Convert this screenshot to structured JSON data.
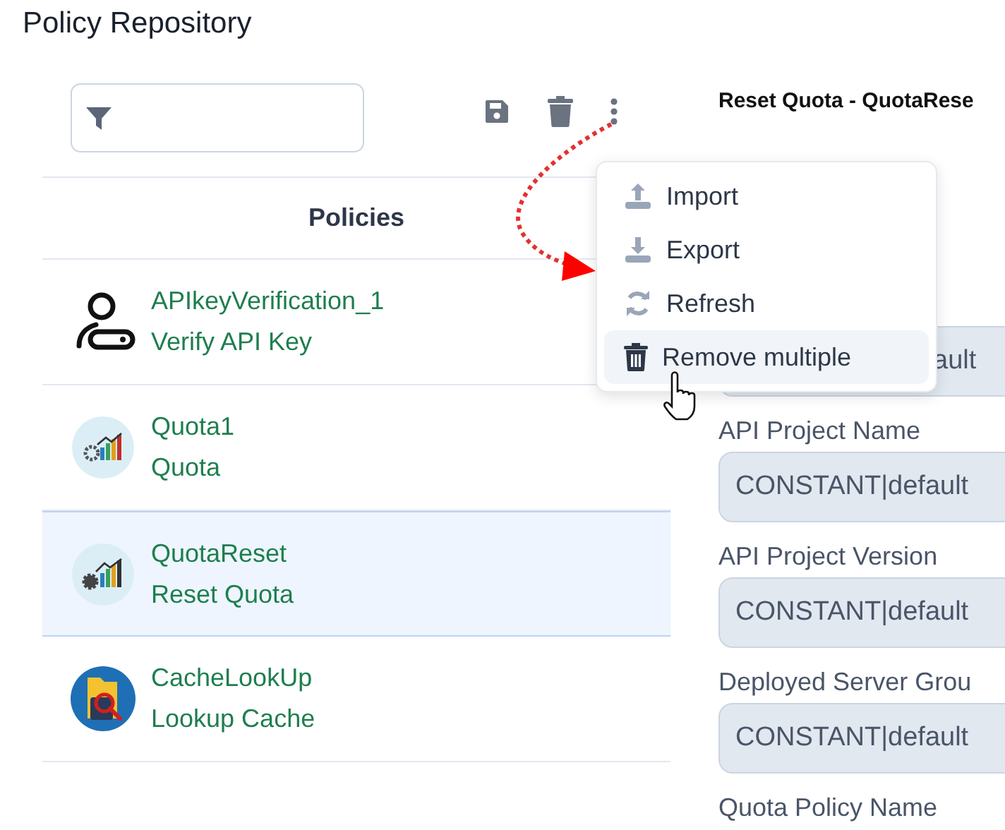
{
  "title": "Policy Repository",
  "toolbar": [
    {
      "kind": "save"
    },
    {
      "kind": "trash"
    },
    {
      "kind": "more"
    }
  ],
  "policies_header": "Policies",
  "policies": [
    {
      "name": "APIkeyVerification_1",
      "type": "Verify API Key",
      "kind": "key-user",
      "selected": false
    },
    {
      "name": "Quota1",
      "type": "Quota",
      "kind": "quota",
      "selected": false
    },
    {
      "name": "QuotaReset",
      "type": "Reset Quota",
      "kind": "quota-reset",
      "selected": true
    },
    {
      "name": "CacheLookUp",
      "type": "Lookup Cache",
      "kind": "cache",
      "selected": false
    }
  ],
  "detail_title": "Reset Quota - QuotaRese",
  "fields": [
    {
      "value": "ault"
    },
    {
      "label": "API Project Name",
      "value": "CONSTANT|default"
    },
    {
      "label": "API Project Version",
      "value": "CONSTANT|default"
    },
    {
      "label": "Deployed Server Grou",
      "value": "CONSTANT|default"
    },
    {
      "label": "Quota Policy Name"
    }
  ],
  "menu": [
    {
      "label": "Import",
      "kind": "import",
      "hovered": false
    },
    {
      "label": "Export",
      "kind": "export",
      "hovered": false
    },
    {
      "label": "Refresh",
      "kind": "refresh",
      "hovered": false
    },
    {
      "label": "Remove multiple",
      "kind": "remove",
      "hovered": true
    }
  ]
}
